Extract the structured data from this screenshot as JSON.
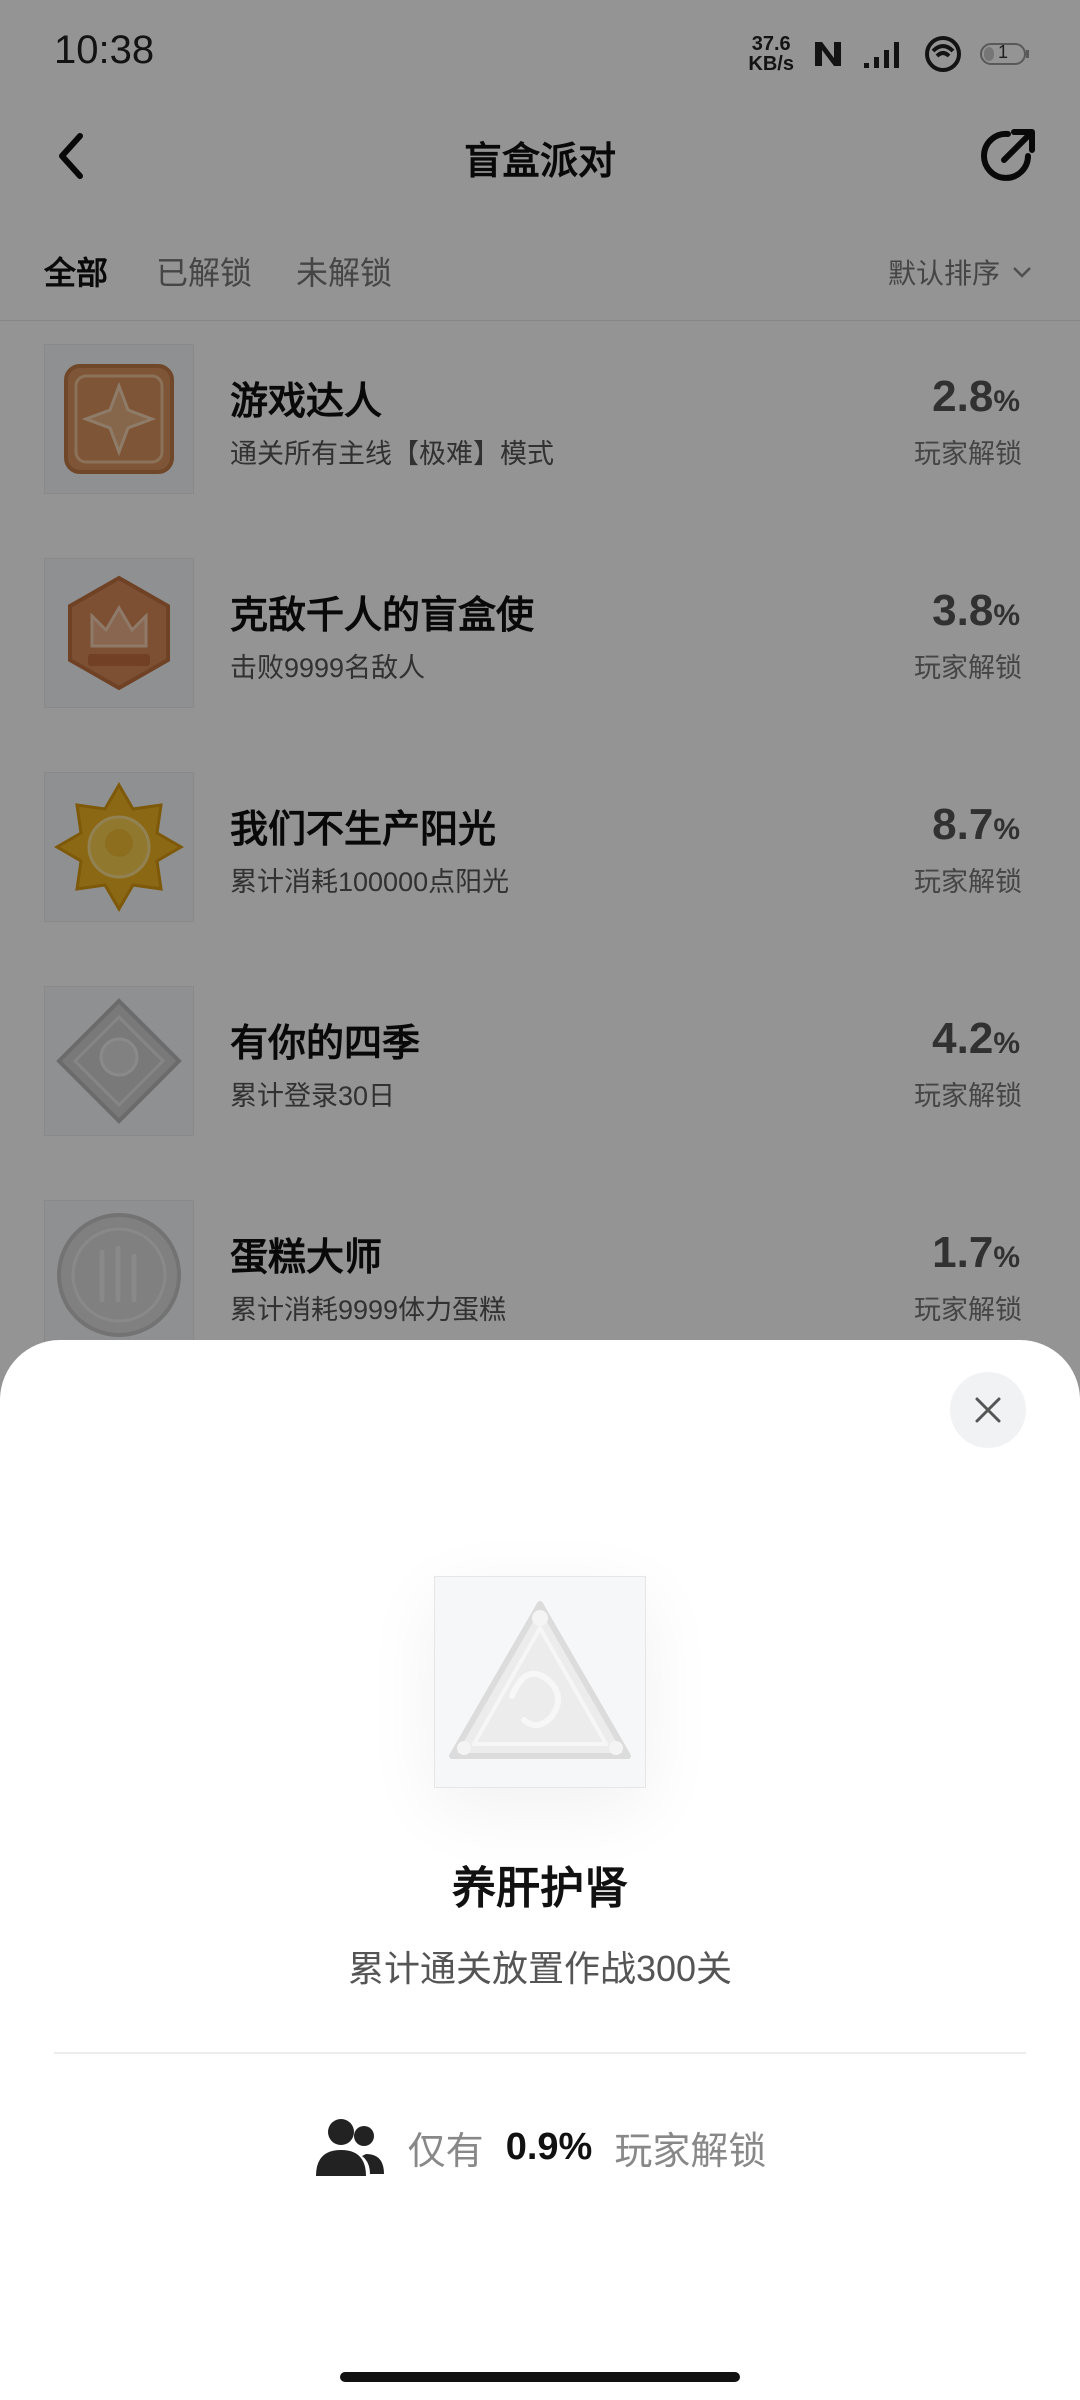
{
  "status_bar": {
    "time": "10:38",
    "net_speed_value": "37.6",
    "net_speed_unit": "KB/s",
    "battery_level": "1",
    "icons": [
      "nfc-icon",
      "signal-icon",
      "hotspot-icon",
      "battery-icon"
    ]
  },
  "nav": {
    "title": "盲盒派对",
    "back_icon": "chevron-left-icon",
    "share_icon": "share-icon"
  },
  "tabs": [
    {
      "label": "全部",
      "active": true
    },
    {
      "label": "已解锁",
      "active": false
    },
    {
      "label": "未解锁",
      "active": false
    }
  ],
  "sort": {
    "label": "默认排序",
    "icon": "chevron-down-icon"
  },
  "achievements": [
    {
      "title": "游戏达人",
      "desc": "通关所有主线【极难】模式",
      "pct": "2.8",
      "unit": "%",
      "sub": "玩家解锁",
      "badge_color": "#d9935e"
    },
    {
      "title": "克敌千人的盲盒使",
      "desc": "击败9999名敌人",
      "pct": "3.8",
      "unit": "%",
      "sub": "玩家解锁",
      "badge_color": "#d88a5a"
    },
    {
      "title": "我们不生产阳光",
      "desc": "累计消耗100000点阳光",
      "pct": "8.7",
      "unit": "%",
      "sub": "玩家解锁",
      "badge_color": "#f0b323"
    },
    {
      "title": "有你的四季",
      "desc": "累计登录30日",
      "pct": "4.2",
      "unit": "%",
      "sub": "玩家解锁",
      "badge_color": "#c8c8c8"
    },
    {
      "title": "蛋糕大师",
      "desc": "累计消耗9999体力蛋糕",
      "pct": "1.7",
      "unit": "%",
      "sub": "玩家解锁",
      "badge_color": "#d4d4d4"
    }
  ],
  "sheet": {
    "title": "养肝护肾",
    "desc": "累计通关放置作战300关",
    "stat_prefix": "仅有",
    "stat_pct": "0.9%",
    "stat_suffix": "玩家解锁",
    "close_icon": "close-icon",
    "users_icon": "users-icon"
  },
  "colors": {
    "overlay": "rgba(0,0,0,0.42)",
    "sheet_bg": "#ffffff",
    "text_primary": "#111111",
    "text_secondary": "#777777"
  }
}
